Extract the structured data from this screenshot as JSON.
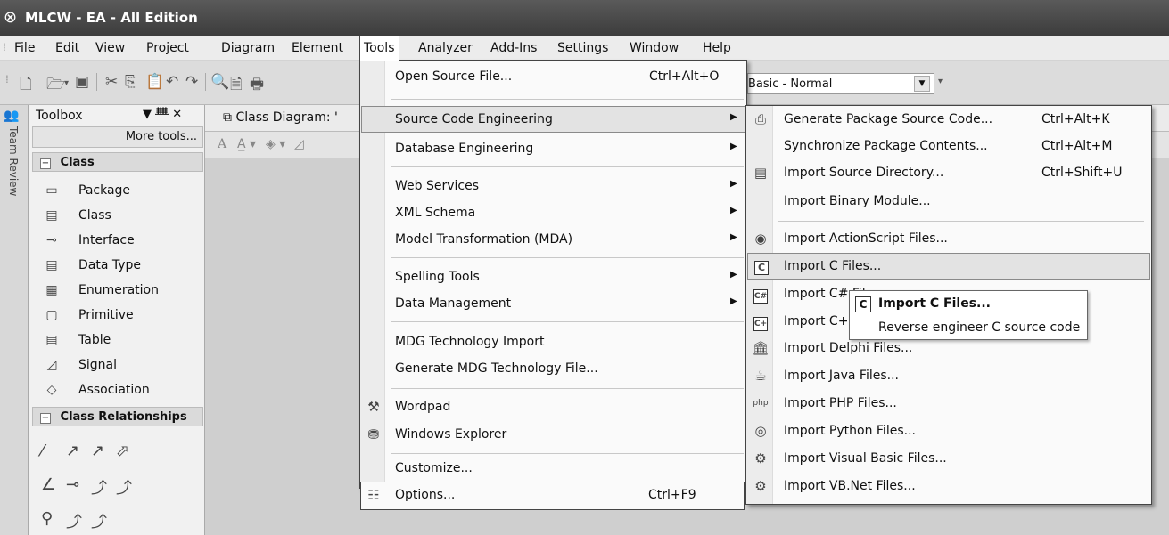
{
  "window": {
    "logo_icon": "⊗",
    "title": "MLCW - EA - All Edition"
  },
  "menubar": {
    "items": [
      "File",
      "Edit",
      "View",
      "Project",
      "Diagram",
      "Element",
      "Tools",
      "Analyzer",
      "Add-Ins",
      "Settings",
      "Window",
      "Help"
    ],
    "active": "Tools"
  },
  "toolbar": {
    "workspace_combo": "Basic - Normal"
  },
  "sidestrip": {
    "label": "Team Review"
  },
  "toolbox": {
    "title": "Toolbox",
    "controls": "▼ ᚙ ✕",
    "more_tools": "More tools...",
    "class_section": "Class",
    "class_items": [
      {
        "label": "Package",
        "icon": "package-icon",
        "glyph": "▭"
      },
      {
        "label": "Class",
        "icon": "class-icon",
        "glyph": "▤"
      },
      {
        "label": "Interface",
        "icon": "interface-icon",
        "glyph": "⊸"
      },
      {
        "label": "Data Type",
        "icon": "datatype-icon",
        "glyph": "▤"
      },
      {
        "label": "Enumeration",
        "icon": "enumeration-icon",
        "glyph": "▦"
      },
      {
        "label": "Primitive",
        "icon": "primitive-icon",
        "glyph": "▢"
      },
      {
        "label": "Table",
        "icon": "table-icon",
        "glyph": "▤"
      },
      {
        "label": "Signal",
        "icon": "signal-icon",
        "glyph": "◿"
      },
      {
        "label": "Association",
        "icon": "association-icon",
        "glyph": "◇"
      }
    ],
    "relationships_section": "Class Relationships"
  },
  "diagram": {
    "tab_label": "Class Diagram: '"
  },
  "tools_menu": {
    "items": [
      {
        "label": "Open Source File...",
        "shortcut": "Ctrl+Alt+O",
        "submenu": false
      },
      {
        "label": "Source Code Engineering",
        "shortcut": "",
        "submenu": true
      },
      {
        "label": "Database Engineering",
        "shortcut": "",
        "submenu": true
      },
      {
        "label": "Web Services",
        "shortcut": "",
        "submenu": true
      },
      {
        "label": "XML Schema",
        "shortcut": "",
        "submenu": true
      },
      {
        "label": "Model Transformation (MDA)",
        "shortcut": "",
        "submenu": true
      },
      {
        "label": "Spelling Tools",
        "shortcut": "",
        "submenu": true
      },
      {
        "label": "Data Management",
        "shortcut": "",
        "submenu": true
      },
      {
        "label": "MDG Technology Import",
        "shortcut": "",
        "submenu": false
      },
      {
        "label": "Generate MDG Technology File...",
        "shortcut": "",
        "submenu": false
      },
      {
        "label": "Wordpad",
        "shortcut": "",
        "submenu": false,
        "icon": "wordpad-icon"
      },
      {
        "label": "Windows Explorer",
        "shortcut": "",
        "submenu": false,
        "icon": "windows-explorer-icon"
      },
      {
        "label": "Customize...",
        "shortcut": "",
        "submenu": false
      },
      {
        "label": "Options...",
        "shortcut": "Ctrl+F9",
        "submenu": false,
        "icon": "options-icon"
      }
    ],
    "highlighted": "Source Code Engineering"
  },
  "source_code_submenu": {
    "items": [
      {
        "label": "Generate Package Source Code...",
        "shortcut": "Ctrl+Alt+K",
        "icon": "generate-code-icon"
      },
      {
        "label": "Synchronize Package Contents...",
        "shortcut": "Ctrl+Alt+M",
        "icon": ""
      },
      {
        "label": "Import Source Directory...",
        "shortcut": "Ctrl+Shift+U",
        "icon": "source-directory-icon"
      },
      {
        "label": "Import Binary Module...",
        "shortcut": "",
        "icon": ""
      },
      {
        "label": "Import ActionScript Files...",
        "shortcut": "",
        "icon": "actionscript-icon"
      },
      {
        "label": "Import C Files...",
        "shortcut": "",
        "icon": "c-file-icon"
      },
      {
        "label": "Import C# Files...",
        "shortcut": "",
        "icon": "csharp-file-icon"
      },
      {
        "label": "Import C++ Files...",
        "shortcut": "",
        "icon": "cpp-file-icon"
      },
      {
        "label": "Import Delphi Files...",
        "shortcut": "",
        "icon": "delphi-icon"
      },
      {
        "label": "Import Java Files...",
        "shortcut": "",
        "icon": "java-icon"
      },
      {
        "label": "Import PHP Files...",
        "shortcut": "",
        "icon": "php-icon"
      },
      {
        "label": "Import Python Files...",
        "shortcut": "",
        "icon": "python-icon"
      },
      {
        "label": "Import Visual Basic Files...",
        "shortcut": "",
        "icon": "visual-basic-icon"
      },
      {
        "label": "Import VB.Net Files...",
        "shortcut": "",
        "icon": "vbnet-icon"
      }
    ],
    "highlighted": "Import C Files..."
  },
  "tooltip": {
    "title": "Import C Files...",
    "description": "Reverse engineer C source code",
    "icon_letter": "C"
  }
}
